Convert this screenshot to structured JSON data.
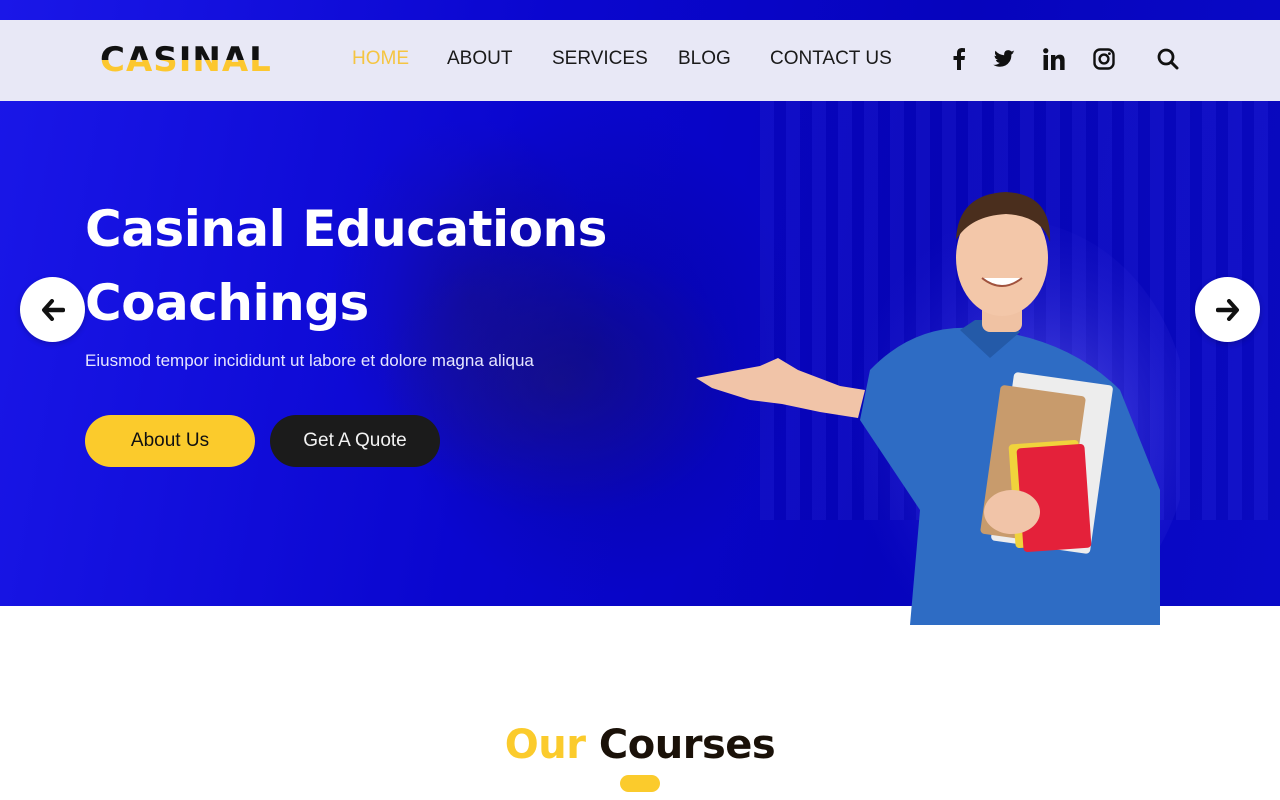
{
  "brand": {
    "logo_text": "CASINAL"
  },
  "nav": {
    "items": [
      {
        "label": "HOME",
        "active": true
      },
      {
        "label": "ABOUT",
        "active": false
      },
      {
        "label": "SERVICES",
        "active": false
      },
      {
        "label": "BLOG",
        "active": false
      },
      {
        "label": "CONTACT US",
        "active": false
      }
    ],
    "social_icons": [
      "facebook-icon",
      "twitter-icon",
      "linkedin-icon",
      "instagram-icon"
    ],
    "search_icon": "search-icon"
  },
  "hero": {
    "title_line1": "Casinal Educations",
    "title_line2": "Coachings",
    "subtitle": "Eiusmod tempor incididunt ut labore et dolore magna aliqua",
    "primary_button": "About Us",
    "secondary_button": "Get A Quote",
    "prev_icon": "arrow-left-icon",
    "next_icon": "arrow-right-icon"
  },
  "courses": {
    "title_accent": "Our",
    "title_main": "Courses"
  },
  "colors": {
    "accent": "#fbcb2c",
    "hero_blue": "#0a06cf",
    "nav_bg": "#e8e8f6",
    "dark_button": "#1b1b1b"
  }
}
